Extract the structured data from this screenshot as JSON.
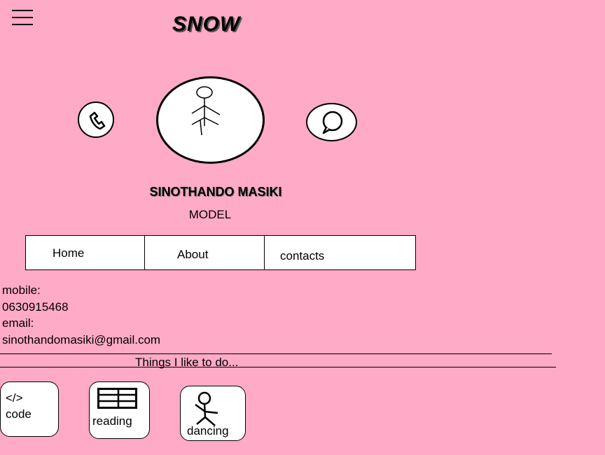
{
  "header": {
    "brand": "SNOW",
    "menu_icon": "hamburger-icon"
  },
  "profile": {
    "name": "SINOTHANDO MASIKI",
    "role": "MODEL",
    "icons": {
      "phone": "phone-icon",
      "avatar": "stick-figure-icon",
      "chat": "chat-bubble-icon"
    }
  },
  "nav": {
    "items": [
      {
        "label": "Home"
      },
      {
        "label": "About"
      },
      {
        "label": "contacts"
      }
    ]
  },
  "contact": {
    "mobile_label": "mobile:",
    "mobile_value": "0630915468",
    "email_label": "email:",
    "email_value": "sinothandomasiki@gmail.com"
  },
  "likes": {
    "title": "Things I like to do...",
    "items": [
      {
        "glyph": "</>",
        "label": "code",
        "icon": "code-icon"
      },
      {
        "label": "reading",
        "icon": "book-icon"
      },
      {
        "label": "dancing",
        "icon": "dancer-icon"
      }
    ]
  },
  "colors": {
    "background": "#ffaac7",
    "card": "#ffffff",
    "ink": "#000000"
  }
}
